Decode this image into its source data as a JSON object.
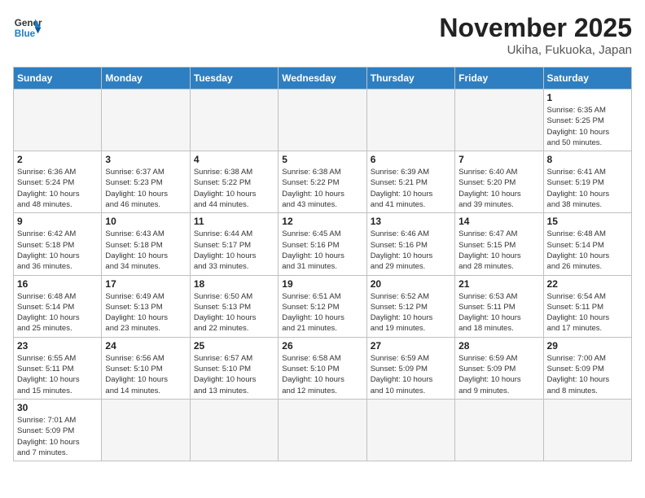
{
  "header": {
    "logo_general": "General",
    "logo_blue": "Blue",
    "month_year": "November 2025",
    "location": "Ukiha, Fukuoka, Japan"
  },
  "weekdays": [
    "Sunday",
    "Monday",
    "Tuesday",
    "Wednesday",
    "Thursday",
    "Friday",
    "Saturday"
  ],
  "weeks": [
    [
      {
        "day": "",
        "info": ""
      },
      {
        "day": "",
        "info": ""
      },
      {
        "day": "",
        "info": ""
      },
      {
        "day": "",
        "info": ""
      },
      {
        "day": "",
        "info": ""
      },
      {
        "day": "",
        "info": ""
      },
      {
        "day": "1",
        "info": "Sunrise: 6:35 AM\nSunset: 5:25 PM\nDaylight: 10 hours\nand 50 minutes."
      }
    ],
    [
      {
        "day": "2",
        "info": "Sunrise: 6:36 AM\nSunset: 5:24 PM\nDaylight: 10 hours\nand 48 minutes."
      },
      {
        "day": "3",
        "info": "Sunrise: 6:37 AM\nSunset: 5:23 PM\nDaylight: 10 hours\nand 46 minutes."
      },
      {
        "day": "4",
        "info": "Sunrise: 6:38 AM\nSunset: 5:22 PM\nDaylight: 10 hours\nand 44 minutes."
      },
      {
        "day": "5",
        "info": "Sunrise: 6:38 AM\nSunset: 5:22 PM\nDaylight: 10 hours\nand 43 minutes."
      },
      {
        "day": "6",
        "info": "Sunrise: 6:39 AM\nSunset: 5:21 PM\nDaylight: 10 hours\nand 41 minutes."
      },
      {
        "day": "7",
        "info": "Sunrise: 6:40 AM\nSunset: 5:20 PM\nDaylight: 10 hours\nand 39 minutes."
      },
      {
        "day": "8",
        "info": "Sunrise: 6:41 AM\nSunset: 5:19 PM\nDaylight: 10 hours\nand 38 minutes."
      }
    ],
    [
      {
        "day": "9",
        "info": "Sunrise: 6:42 AM\nSunset: 5:18 PM\nDaylight: 10 hours\nand 36 minutes."
      },
      {
        "day": "10",
        "info": "Sunrise: 6:43 AM\nSunset: 5:18 PM\nDaylight: 10 hours\nand 34 minutes."
      },
      {
        "day": "11",
        "info": "Sunrise: 6:44 AM\nSunset: 5:17 PM\nDaylight: 10 hours\nand 33 minutes."
      },
      {
        "day": "12",
        "info": "Sunrise: 6:45 AM\nSunset: 5:16 PM\nDaylight: 10 hours\nand 31 minutes."
      },
      {
        "day": "13",
        "info": "Sunrise: 6:46 AM\nSunset: 5:16 PM\nDaylight: 10 hours\nand 29 minutes."
      },
      {
        "day": "14",
        "info": "Sunrise: 6:47 AM\nSunset: 5:15 PM\nDaylight: 10 hours\nand 28 minutes."
      },
      {
        "day": "15",
        "info": "Sunrise: 6:48 AM\nSunset: 5:14 PM\nDaylight: 10 hours\nand 26 minutes."
      }
    ],
    [
      {
        "day": "16",
        "info": "Sunrise: 6:48 AM\nSunset: 5:14 PM\nDaylight: 10 hours\nand 25 minutes."
      },
      {
        "day": "17",
        "info": "Sunrise: 6:49 AM\nSunset: 5:13 PM\nDaylight: 10 hours\nand 23 minutes."
      },
      {
        "day": "18",
        "info": "Sunrise: 6:50 AM\nSunset: 5:13 PM\nDaylight: 10 hours\nand 22 minutes."
      },
      {
        "day": "19",
        "info": "Sunrise: 6:51 AM\nSunset: 5:12 PM\nDaylight: 10 hours\nand 21 minutes."
      },
      {
        "day": "20",
        "info": "Sunrise: 6:52 AM\nSunset: 5:12 PM\nDaylight: 10 hours\nand 19 minutes."
      },
      {
        "day": "21",
        "info": "Sunrise: 6:53 AM\nSunset: 5:11 PM\nDaylight: 10 hours\nand 18 minutes."
      },
      {
        "day": "22",
        "info": "Sunrise: 6:54 AM\nSunset: 5:11 PM\nDaylight: 10 hours\nand 17 minutes."
      }
    ],
    [
      {
        "day": "23",
        "info": "Sunrise: 6:55 AM\nSunset: 5:11 PM\nDaylight: 10 hours\nand 15 minutes."
      },
      {
        "day": "24",
        "info": "Sunrise: 6:56 AM\nSunset: 5:10 PM\nDaylight: 10 hours\nand 14 minutes."
      },
      {
        "day": "25",
        "info": "Sunrise: 6:57 AM\nSunset: 5:10 PM\nDaylight: 10 hours\nand 13 minutes."
      },
      {
        "day": "26",
        "info": "Sunrise: 6:58 AM\nSunset: 5:10 PM\nDaylight: 10 hours\nand 12 minutes."
      },
      {
        "day": "27",
        "info": "Sunrise: 6:59 AM\nSunset: 5:09 PM\nDaylight: 10 hours\nand 10 minutes."
      },
      {
        "day": "28",
        "info": "Sunrise: 6:59 AM\nSunset: 5:09 PM\nDaylight: 10 hours\nand 9 minutes."
      },
      {
        "day": "29",
        "info": "Sunrise: 7:00 AM\nSunset: 5:09 PM\nDaylight: 10 hours\nand 8 minutes."
      }
    ],
    [
      {
        "day": "30",
        "info": "Sunrise: 7:01 AM\nSunset: 5:09 PM\nDaylight: 10 hours\nand 7 minutes."
      },
      {
        "day": "",
        "info": ""
      },
      {
        "day": "",
        "info": ""
      },
      {
        "day": "",
        "info": ""
      },
      {
        "day": "",
        "info": ""
      },
      {
        "day": "",
        "info": ""
      },
      {
        "day": "",
        "info": ""
      }
    ]
  ]
}
